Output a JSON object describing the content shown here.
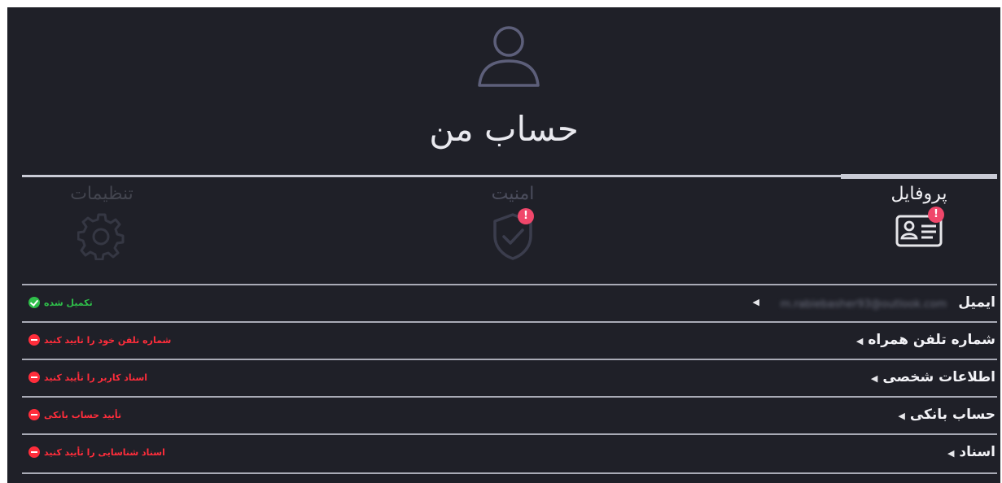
{
  "header": {
    "title": "حساب من"
  },
  "tabs": [
    {
      "label": "پروفایل",
      "icon": "id-card-icon",
      "alert": "!"
    },
    {
      "label": "امنیت",
      "icon": "shield-check-icon",
      "alert": "!"
    },
    {
      "label": "تنظیمات",
      "icon": "gear-icon"
    }
  ],
  "rows": [
    {
      "label": "ایمیل",
      "value": "m.rabiebasher93@outlook.com",
      "status": "تکمیل شده",
      "status_type": "success"
    },
    {
      "label": "شماره تلفن همراه",
      "status": "شماره تلفن خود را تایید کنید",
      "status_type": "error"
    },
    {
      "label": "اطلاعات شخصی",
      "status": "اسناد کاربر را تأیید کنید",
      "status_type": "error"
    },
    {
      "label": "حساب بانکی",
      "status": "تأیید حساب بانکی",
      "status_type": "error"
    },
    {
      "label": "اسناد",
      "status": "اسناد شناسایی را تأیید کنید",
      "status_type": "error"
    }
  ],
  "colors": {
    "background": "#1f2028",
    "success": "#2fbf4a",
    "error": "#ff2d3b",
    "alert": "#f0476b"
  }
}
